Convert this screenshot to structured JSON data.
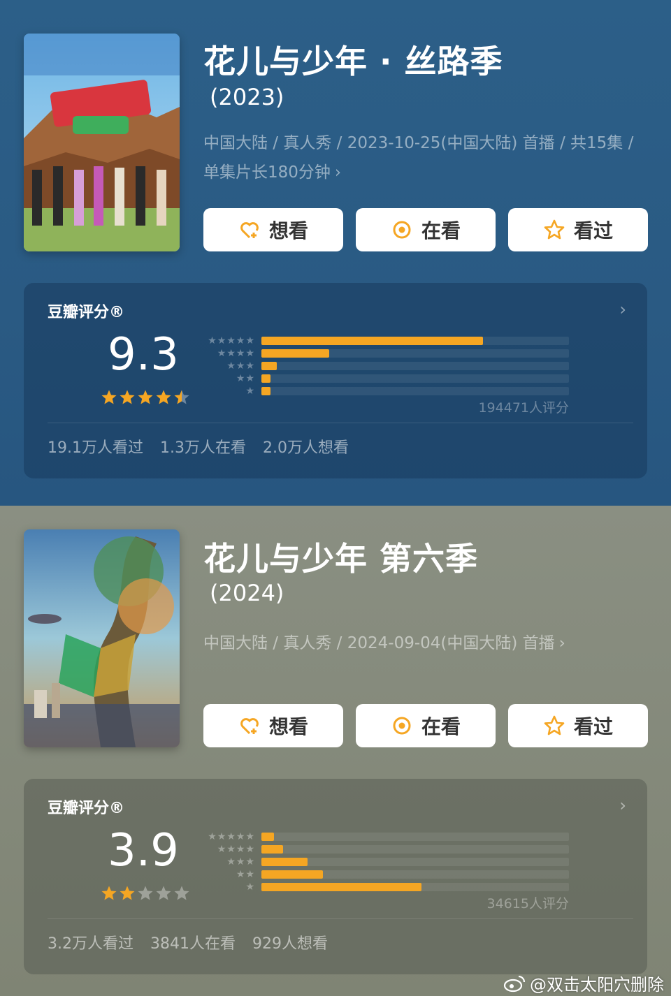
{
  "shows": [
    {
      "title": "花儿与少年 · 丝路季",
      "year": "(2023)",
      "meta": "中国大陆 / 真人秀 / 2023-10-25(中国大陆) 首播 / 共15集 / 单集片长180分钟",
      "buttons": {
        "want": "想看",
        "watching": "在看",
        "watched": "看过"
      },
      "rating": {
        "label": "豆瓣评分®",
        "score": "9.3",
        "stars": 4.5,
        "distribution": [
          0.72,
          0.22,
          0.05,
          0.03,
          0.03
        ],
        "count": "194471人评分"
      },
      "stats": {
        "watched": "19.1万人看过",
        "watching": "1.3万人在看",
        "want": "2.0万人想看"
      },
      "colors": {
        "accent": "#f5a623",
        "background": "#2c5f88"
      }
    },
    {
      "title": "花儿与少年 第六季",
      "year": "(2024)",
      "meta": "中国大陆 / 真人秀 / 2024-09-04(中国大陆) 首播",
      "buttons": {
        "want": "想看",
        "watching": "在看",
        "watched": "看过"
      },
      "rating": {
        "label": "豆瓣评分®",
        "score": "3.9",
        "stars": 2,
        "distribution": [
          0.04,
          0.07,
          0.15,
          0.2,
          0.52
        ],
        "count": "34615人评分"
      },
      "stats": {
        "watched": "3.2万人看过",
        "watching": "3841人在看",
        "want": "929人想看"
      },
      "colors": {
        "accent": "#f5a623",
        "background": "#8a8f82"
      }
    }
  ],
  "watermark": "@双击太阳穴删除",
  "icons": {
    "want": "heart-plus-icon",
    "watching": "target-icon",
    "watched": "star-outline-icon",
    "more": "chevron-right-icon",
    "weibo": "weibo-logo-icon"
  }
}
